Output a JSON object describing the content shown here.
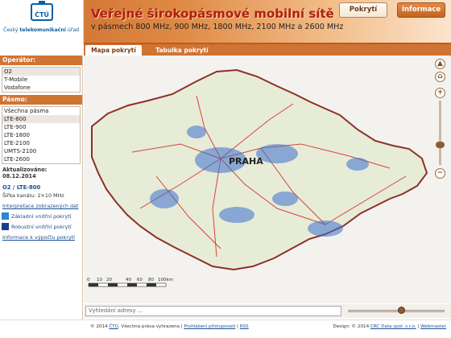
{
  "header": {
    "logo_text_prefix": "Český ",
    "logo_text_bold": "telekomunikační",
    "logo_text_suffix": " úřad",
    "logo_mark": "ČTÚ",
    "title": "Veřejné širokopásmové mobilní sítě",
    "subtitle": "v pásmech 800 MHz, 900 MHz, 1800 MHz, 2100 MHz a 2600 MHz",
    "btn_pokryti": "Pokrytí",
    "btn_info": "Informace"
  },
  "tabs": [
    {
      "label": "Mapa pokrytí"
    },
    {
      "label": "Tabulka pokrytí"
    }
  ],
  "sidebar": {
    "operator_title": "Operátor:",
    "operators": [
      "O2",
      "T-Mobile",
      "Vodafone"
    ],
    "band_title": "Pásmo:",
    "bands": [
      "Všechna pásma",
      "LTE-800",
      "LTE-900",
      "LTE-1800",
      "LTE-2100",
      "UMTS-2100",
      "LTE-2600"
    ],
    "update_label": "Aktualizováno:",
    "update_date": "08.12.2014",
    "selection": "O2 / LTE-800",
    "channel": "Šířka kanálu: 2×10 MHz",
    "interp_link": "Interpretace zobrazených dat",
    "legend": [
      {
        "label": "Základní vnitřní pokrytí",
        "color": "#2a86d6"
      },
      {
        "label": "Robustní vnitřní pokrytí",
        "color": "#173e8c"
      }
    ],
    "calc_link": "Informace k výpočtu pokrytí"
  },
  "map": {
    "city_label": "PRAHA",
    "scale_labels": [
      "0",
      "10",
      "20",
      "40",
      "60",
      "80",
      "100km"
    ],
    "colors": {
      "land": "#e7ecd7",
      "border": "#8e2f2a",
      "road": "#d4463b",
      "coverage": "#3b6fce",
      "water": "#8ec1e6"
    }
  },
  "search": {
    "placeholder": "Vyhledání adresy ..."
  },
  "footer": {
    "copyright_prefix": "© 2014 ",
    "copyright_link": "ČTÚ",
    "copyright_text": ", Všechna práva vyhrazena | ",
    "accessibility": "Prohlášení přístupnosti",
    "sep": " | ",
    "rss": "RSS",
    "design_prefix": "Design: © 2014 ",
    "design_link": "CRC Data spol. s r.o.",
    "design_sep": " | ",
    "webmaster": "Webmaster"
  }
}
